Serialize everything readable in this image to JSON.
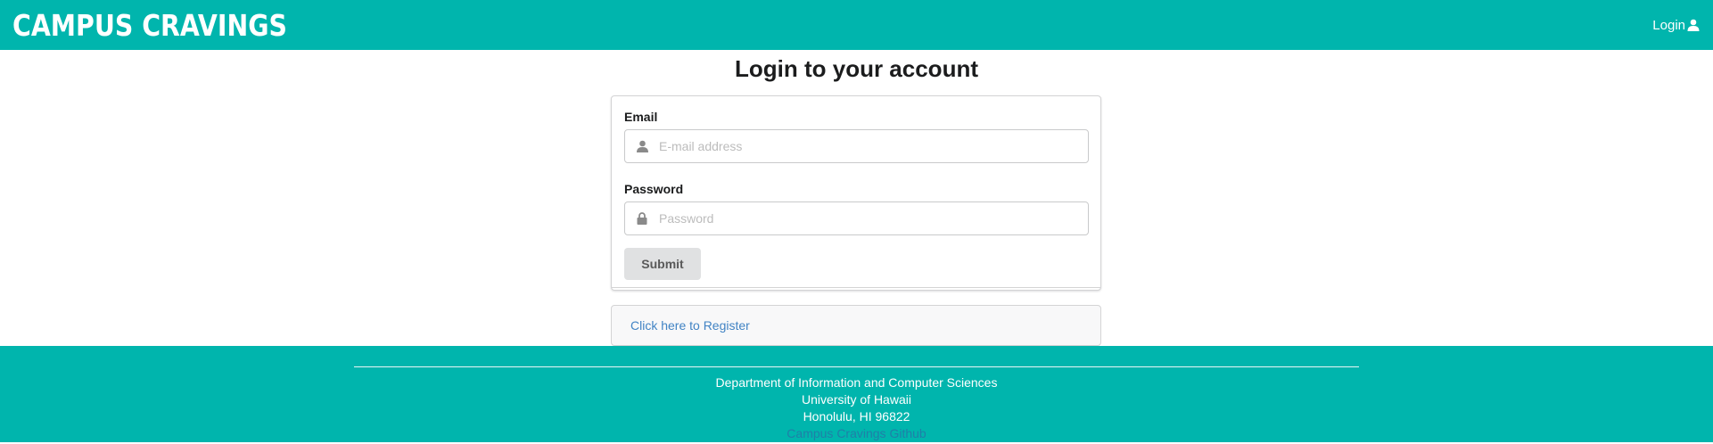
{
  "header": {
    "logo_text": "CAMPUS CRAVINGS",
    "login_label": "Login",
    "colors": {
      "brand": "#00b5ad"
    }
  },
  "main": {
    "title": "Login to your account",
    "email": {
      "label": "Email",
      "placeholder": "E-mail address",
      "icon": "user-icon"
    },
    "password": {
      "label": "Password",
      "placeholder": "Password",
      "icon": "lock-icon"
    },
    "submit_label": "Submit",
    "register_link": "Click here to Register"
  },
  "footer": {
    "line1": "Department of Information and Computer Sciences",
    "line2": "University of Hawaii",
    "line3": "Honolulu, HI 96822",
    "github_link": "Campus Cravings Github"
  }
}
